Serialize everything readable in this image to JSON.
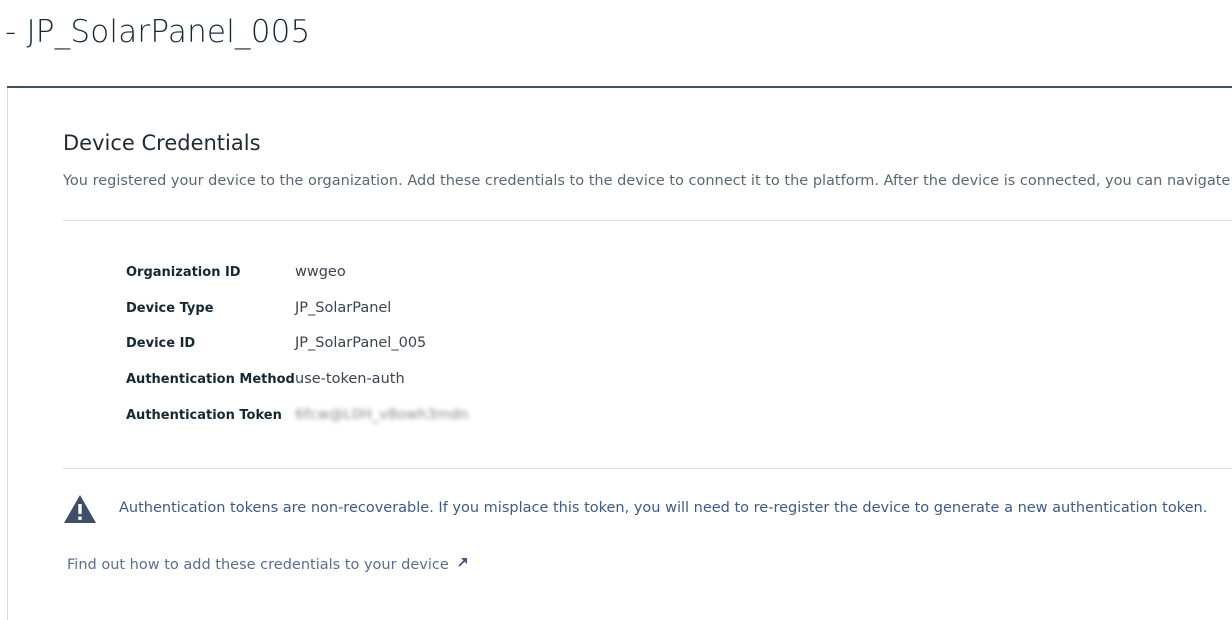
{
  "header": {
    "title": "- JP_SolarPanel_005"
  },
  "section": {
    "title": "Device Credentials",
    "description": "You registered your device to the organization. Add these credentials to the device to connect it to the platform. After the device is connected, you can navigate to view"
  },
  "credentials": [
    {
      "label": "Organization ID",
      "value": "wwgeo"
    },
    {
      "label": "Device Type",
      "value": "JP_SolarPanel"
    },
    {
      "label": "Device ID",
      "value": "JP_SolarPanel_005"
    },
    {
      "label": "Authentication Method",
      "value": "use-token-auth"
    },
    {
      "label": "Authentication Token",
      "value": "6fcw@L0H_v8owh3mdn"
    }
  ],
  "warning": {
    "icon": "warning-icon",
    "text": "Authentication tokens are non-recoverable. If you misplace this token, you will need to re-register the device to generate a new authentication token."
  },
  "help_link": {
    "text": "Find out how to add these credentials to your device",
    "icon": "external-arrow-icon"
  },
  "colors": {
    "accent": "#3d5a8c",
    "header_rule": "#3d4e66",
    "warning_icon": "#3d4e66"
  }
}
